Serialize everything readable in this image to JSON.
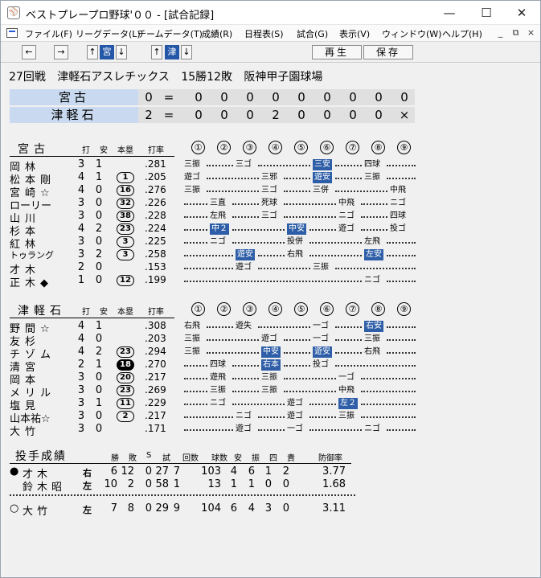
{
  "window": {
    "title": "ベストプレープロ野球'００ - [試合記録]",
    "icon": "baseball-app-icon",
    "controls": {
      "minimize": "—",
      "maximize": "☐",
      "close": "✕"
    }
  },
  "menu": {
    "items": [
      "ファイル(F)",
      "リーグデータ(L)",
      "チームデータ(T)",
      "成績(R)",
      "日程表(S)",
      "試合(G)",
      "表示(V)",
      "ウィンドウ(W)",
      "ヘルプ(H)"
    ],
    "mdi": {
      "minimize": "_",
      "restore": "⧉",
      "close": "×"
    }
  },
  "toolbar": {
    "prev": "←",
    "next": "→",
    "team1_up": "↑",
    "team1": "宮",
    "team1_down": "↓",
    "team2_up": "↑",
    "team2": "津",
    "team2_down": "↓",
    "play": "再生",
    "save": "保存"
  },
  "game": {
    "round": "27回戦",
    "team": "津軽石アスレチックス",
    "record": "15勝12敗",
    "stadium": "阪神甲子園球場"
  },
  "linescore": [
    {
      "team": "宮古",
      "total": "0",
      "eq": "=",
      "innings": [
        "0",
        "0",
        "0",
        "0",
        "0",
        "0",
        "0",
        "0",
        "0"
      ]
    },
    {
      "team": "津軽石",
      "total": "2",
      "eq": "=",
      "innings": [
        "0",
        "0",
        "0",
        "2",
        "0",
        "0",
        "0",
        "0",
        "×"
      ]
    }
  ],
  "batting_headers": {
    "ab": "打",
    "hits": "安",
    "hr": "本塁",
    "avg": "打率",
    "innings": [
      "①",
      "②",
      "③",
      "④",
      "⑤",
      "⑥",
      "⑦",
      "⑧",
      "⑨"
    ]
  },
  "away": {
    "team": "宮古",
    "batters": [
      {
        "name": "岡林",
        "ab": "3",
        "h": "1",
        "hr": "",
        "hr_filled": false,
        "avg": ".281",
        "results": [
          {
            "inn": 1,
            "t": "三振"
          },
          {
            "inn": 3,
            "t": "三ゴ"
          },
          {
            "inn": 6,
            "t": "三安",
            "hit": true
          },
          {
            "inn": 8,
            "t": "四球"
          }
        ]
      },
      {
        "name": "松本剛",
        "ab": "4",
        "h": "1",
        "hr": "1",
        "hr_filled": false,
        "avg": ".205",
        "results": [
          {
            "inn": 1,
            "t": "遊ゴ"
          },
          {
            "inn": 4,
            "t": "三邪"
          },
          {
            "inn": 6,
            "t": "遊安",
            "hit": true
          },
          {
            "inn": 8,
            "t": "三振"
          }
        ]
      },
      {
        "name": "宮崎☆",
        "ab": "4",
        "h": "0",
        "hr": "16",
        "hr_filled": false,
        "avg": ".276",
        "results": [
          {
            "inn": 1,
            "t": "三振"
          },
          {
            "inn": 4,
            "t": "三ゴ"
          },
          {
            "inn": 6,
            "t": "三併"
          },
          {
            "inn": 9,
            "t": "中飛"
          }
        ]
      },
      {
        "name": "ローリー",
        "ab": "3",
        "h": "0",
        "hr": "32",
        "hr_filled": false,
        "avg": ".226",
        "results": [
          {
            "inn": 2,
            "t": "三直"
          },
          {
            "inn": 4,
            "t": "死球"
          },
          {
            "inn": 7,
            "t": "中飛"
          },
          {
            "inn": 9,
            "t": "ニゴ"
          }
        ]
      },
      {
        "name": "山川",
        "ab": "3",
        "h": "0",
        "hr": "38",
        "hr_filled": false,
        "avg": ".228",
        "results": [
          {
            "inn": 2,
            "t": "左飛"
          },
          {
            "inn": 4,
            "t": "三ゴ"
          },
          {
            "inn": 7,
            "t": "ニゴ"
          },
          {
            "inn": 9,
            "t": "四球"
          }
        ]
      },
      {
        "name": "杉本",
        "ab": "4",
        "h": "2",
        "hr": "23",
        "hr_filled": false,
        "avg": ".224",
        "results": [
          {
            "inn": 2,
            "t": "中２",
            "hit": true
          },
          {
            "inn": 5,
            "t": "中安",
            "hit": true
          },
          {
            "inn": 7,
            "t": "遊ゴ"
          },
          {
            "inn": 9,
            "t": "投ゴ"
          }
        ]
      },
      {
        "name": "紅林",
        "ab": "3",
        "h": "0",
        "hr": "3",
        "hr_filled": false,
        "avg": ".225",
        "results": [
          {
            "inn": 2,
            "t": "ニゴ"
          },
          {
            "inn": 5,
            "t": "投併"
          },
          {
            "inn": 8,
            "t": "左飛"
          }
        ]
      },
      {
        "name": "トゥラング",
        "ab": "3",
        "h": "2",
        "hr": "3",
        "hr_filled": false,
        "avg": ".258",
        "results": [
          {
            "inn": 3,
            "t": "遊安",
            "hit": true
          },
          {
            "inn": 5,
            "t": "右飛"
          },
          {
            "inn": 8,
            "t": "左安",
            "hit": true
          }
        ]
      },
      {
        "name": "才木",
        "ab": "2",
        "h": "0",
        "hr": "",
        "hr_filled": false,
        "avg": ".153",
        "results": [
          {
            "inn": 3,
            "t": "遊ゴ"
          },
          {
            "inn": 6,
            "t": "三振"
          }
        ]
      },
      {
        "name": "正木◆",
        "ab": "1",
        "h": "0",
        "hr": "12",
        "hr_filled": false,
        "avg": ".199",
        "results": [
          {
            "inn": 8,
            "t": "ニゴ"
          }
        ]
      }
    ]
  },
  "home": {
    "team": "津軽石",
    "batters": [
      {
        "name": "野間☆",
        "ab": "4",
        "h": "1",
        "hr": "",
        "hr_filled": false,
        "avg": ".308",
        "results": [
          {
            "inn": 1,
            "t": "右飛"
          },
          {
            "inn": 3,
            "t": "遊失"
          },
          {
            "inn": 6,
            "t": "一ゴ"
          },
          {
            "inn": 8,
            "t": "右安",
            "hit": true
          }
        ]
      },
      {
        "name": "友杉",
        "ab": "4",
        "h": "0",
        "hr": "",
        "hr_filled": false,
        "avg": ".203",
        "results": [
          {
            "inn": 1,
            "t": "三振"
          },
          {
            "inn": 4,
            "t": "遊ゴ"
          },
          {
            "inn": 6,
            "t": "一ゴ"
          },
          {
            "inn": 8,
            "t": "三振"
          }
        ]
      },
      {
        "name": "チゾム",
        "ab": "4",
        "h": "2",
        "hr": "23",
        "hr_filled": false,
        "avg": ".294",
        "results": [
          {
            "inn": 1,
            "t": "三振"
          },
          {
            "inn": 4,
            "t": "中安",
            "hit": true
          },
          {
            "inn": 6,
            "t": "遊安",
            "hit": true
          },
          {
            "inn": 8,
            "t": "右飛"
          }
        ]
      },
      {
        "name": "清宮",
        "ab": "2",
        "h": "1",
        "hr": "18",
        "hr_filled": true,
        "avg": ".270",
        "results": [
          {
            "inn": 2,
            "t": "四球"
          },
          {
            "inn": 4,
            "t": "右本",
            "hit": true
          },
          {
            "inn": 6,
            "t": "投ゴ"
          }
        ]
      },
      {
        "name": "岡本",
        "ab": "3",
        "h": "0",
        "hr": "20",
        "hr_filled": false,
        "avg": ".217",
        "results": [
          {
            "inn": 2,
            "t": "遊飛"
          },
          {
            "inn": 4,
            "t": "三振"
          },
          {
            "inn": 7,
            "t": "一ゴ"
          }
        ]
      },
      {
        "name": "メリル",
        "ab": "3",
        "h": "0",
        "hr": "23",
        "hr_filled": false,
        "avg": ".269",
        "results": [
          {
            "inn": 2,
            "t": "三振"
          },
          {
            "inn": 4,
            "t": "三振"
          },
          {
            "inn": 7,
            "t": "中飛"
          }
        ]
      },
      {
        "name": "塩見",
        "ab": "3",
        "h": "1",
        "hr": "11",
        "hr_filled": false,
        "avg": ".229",
        "results": [
          {
            "inn": 2,
            "t": "ニゴ"
          },
          {
            "inn": 5,
            "t": "遊ゴ"
          },
          {
            "inn": 7,
            "t": "左２",
            "hit": true
          }
        ]
      },
      {
        "name": "山本祐☆",
        "ab": "3",
        "h": "0",
        "hr": "2",
        "hr_filled": false,
        "avg": ".217",
        "results": [
          {
            "inn": 3,
            "t": "ニゴ"
          },
          {
            "inn": 5,
            "t": "遊ゴ"
          },
          {
            "inn": 7,
            "t": "三振"
          }
        ]
      },
      {
        "name": "大竹",
        "ab": "3",
        "h": "0",
        "hr": "",
        "hr_filled": false,
        "avg": ".171",
        "results": [
          {
            "inn": 3,
            "t": "遊ゴ"
          },
          {
            "inn": 5,
            "t": "一ゴ"
          },
          {
            "inn": 8,
            "t": "ニゴ"
          }
        ]
      }
    ]
  },
  "pitching": {
    "title": "投手成績",
    "headers": [
      "勝",
      "敗",
      "S",
      "試",
      "回数",
      "球数",
      "安",
      "振",
      "四",
      "責",
      "防御率"
    ],
    "away": [
      {
        "mark": "●",
        "name": "才木",
        "hand": "右",
        "w": "6",
        "l": "12",
        "s": "0",
        "g": "27",
        "ip": "7",
        "np": "103",
        "h": "4",
        "so": "6",
        "bb": "1",
        "er": "2",
        "era": "3.77"
      },
      {
        "mark": "",
        "name": "鈴木昭",
        "hand": "左",
        "w": "10",
        "l": "2",
        "s": "0",
        "g": "58",
        "ip": "1",
        "np": "13",
        "h": "1",
        "so": "1",
        "bb": "0",
        "er": "0",
        "era": "1.68"
      }
    ],
    "home": [
      {
        "mark": "○",
        "name": "大竹",
        "hand": "左",
        "w": "7",
        "l": "8",
        "s": "0",
        "g": "29",
        "ip": "9",
        "np": "104",
        "h": "6",
        "so": "4",
        "bb": "3",
        "er": "0",
        "era": "3.11"
      }
    ]
  },
  "colors": {
    "hit": "#2e5ea7",
    "team_cell": "#c9daf0",
    "score_bg": "#e0e0e0"
  }
}
